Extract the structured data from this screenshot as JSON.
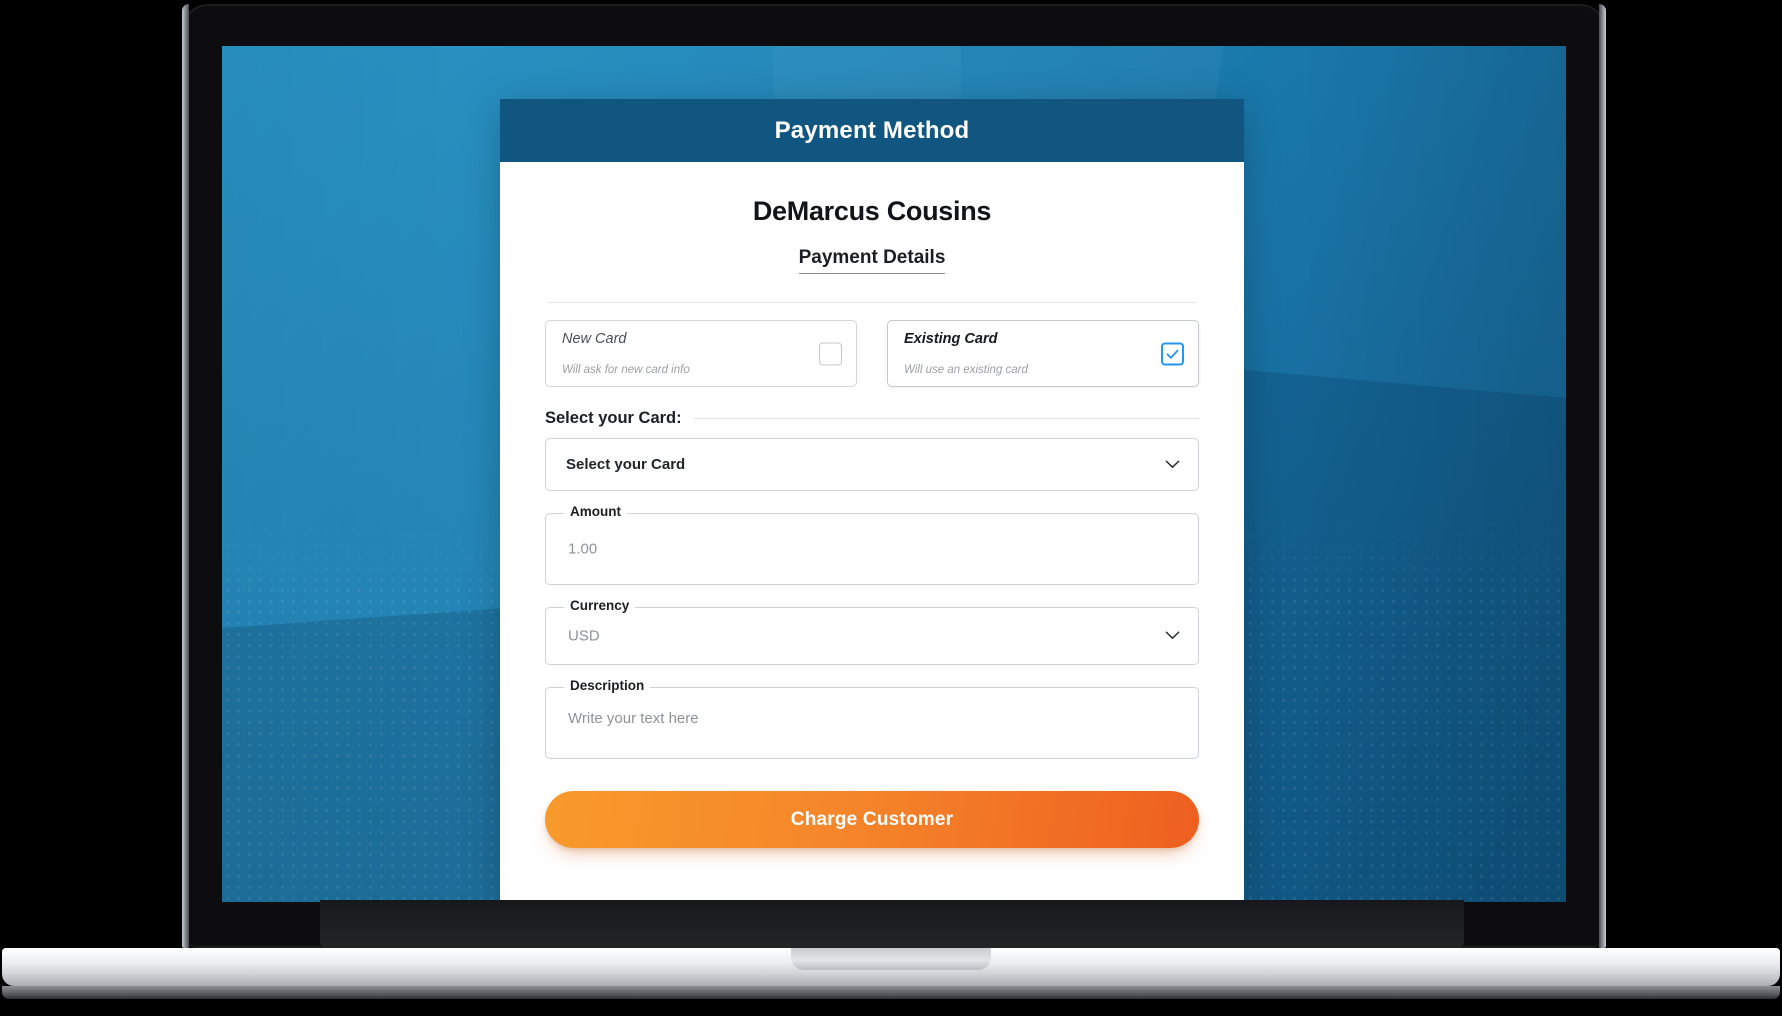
{
  "window": {
    "header_title": "Payment Method"
  },
  "content": {
    "customer_name": "DeMarcus Cousins",
    "section_title": "Payment Details"
  },
  "card_options": [
    {
      "title": "New Card",
      "subtitle": "Will ask for new card info",
      "selected": false,
      "checkbox_icon": "checkbox-empty-icon"
    },
    {
      "title": "Existing Card",
      "subtitle": "Will use an existing card",
      "selected": true,
      "checkbox_icon": "checkbox-checked-icon"
    }
  ],
  "select_card": {
    "legend": "Select your Card:",
    "value": "Select your Card",
    "chevron_icon": "chevron-down-icon"
  },
  "fields": {
    "amount": {
      "label": "Amount",
      "value": "1.00"
    },
    "currency": {
      "label": "Currency",
      "value": "USD",
      "chevron_icon": "chevron-down-icon"
    },
    "description": {
      "label": "Description",
      "placeholder": "Write your text here"
    }
  },
  "actions": {
    "charge_label": "Charge Customer"
  },
  "colors": {
    "header_blue": "#115680",
    "background_blue": "#1b7fb2",
    "accent_checkbox": "#2196f3",
    "button_orange_start": "#f89a2b",
    "button_orange_end": "#ee5f20"
  }
}
